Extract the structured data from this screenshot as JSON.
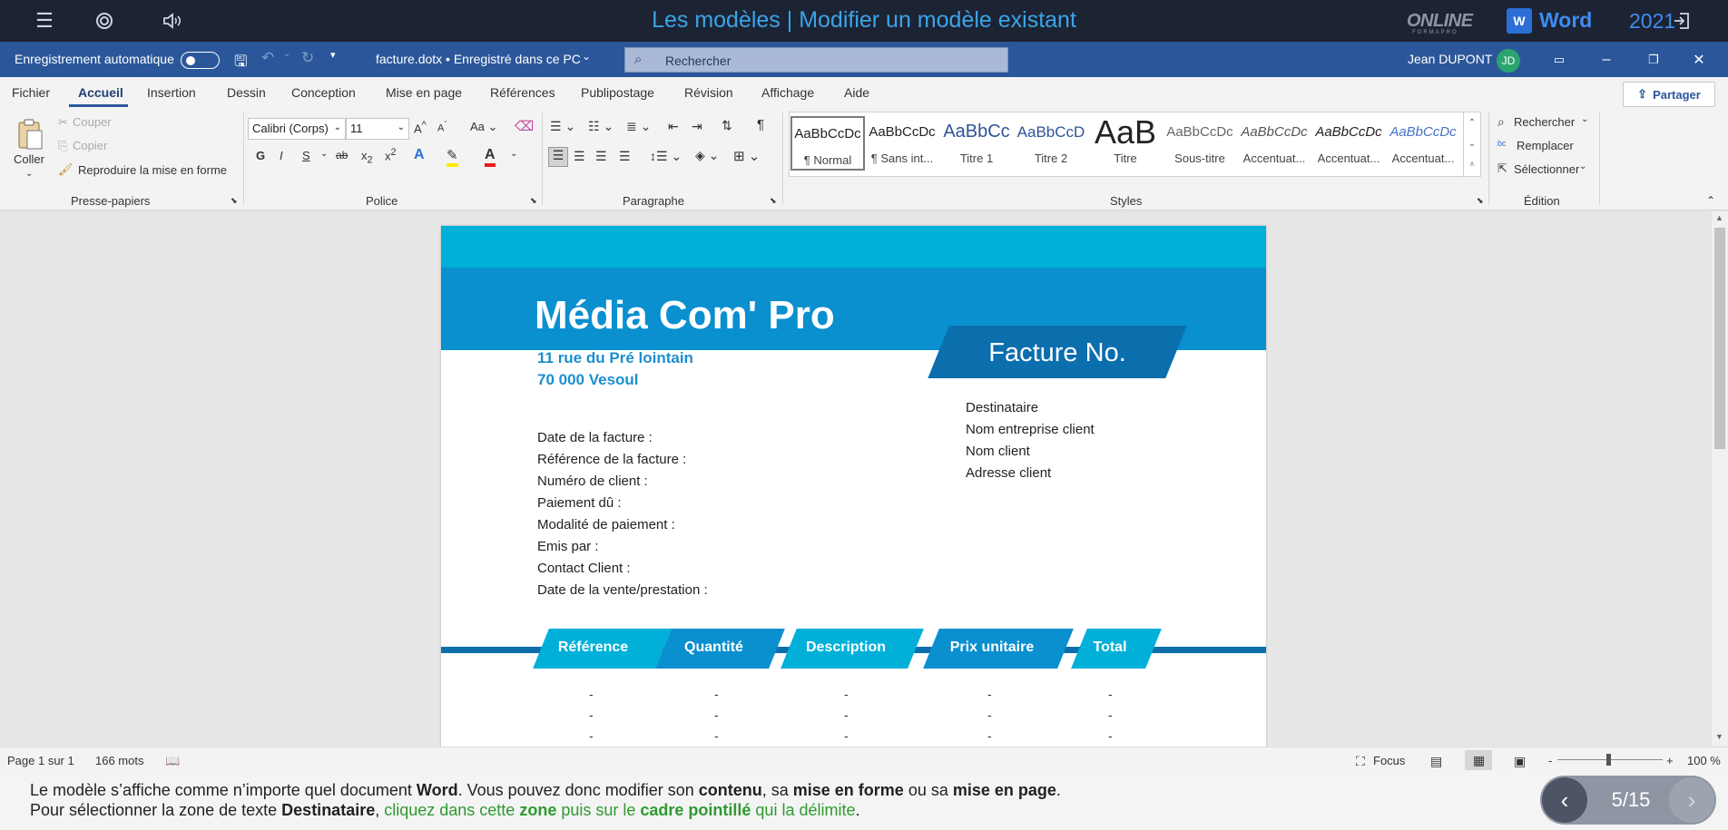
{
  "course": {
    "title": "Les modèles | Modifier un modèle existant",
    "online_logo": "ONLINE",
    "online_sub": "FORMAPRO",
    "word_label": "Word",
    "word_year": "2021",
    "word_letter": "W"
  },
  "titlebar": {
    "autosave": "Enregistrement automatique",
    "filename": "facture.dotx • Enregistré dans ce PC",
    "search_placeholder": "Rechercher",
    "user": "Jean DUPONT",
    "initials": "JD"
  },
  "menu": {
    "tabs": [
      "Fichier",
      "Accueil",
      "Insertion",
      "Dessin",
      "Conception",
      "Mise en page",
      "Références",
      "Publipostage",
      "Révision",
      "Affichage",
      "Aide"
    ],
    "share": "Partager"
  },
  "ribbon": {
    "clipboard": {
      "paste": "Coller",
      "cut": "Couper",
      "copy": "Copier",
      "format_painter": "Reproduire la mise en forme",
      "label": "Presse-papiers"
    },
    "font": {
      "name": "Calibri (Corps)",
      "size": "11",
      "label": "Police",
      "bold": "G",
      "italic": "I",
      "underline": "S"
    },
    "paragraph": {
      "label": "Paragraphe"
    },
    "styles": {
      "label": "Styles",
      "items": [
        {
          "sample": "AaBbCcDc",
          "name": "¶ Normal"
        },
        {
          "sample": "AaBbCcDc",
          "name": "¶ Sans int..."
        },
        {
          "sample": "AaBbCc",
          "name": "Titre 1"
        },
        {
          "sample": "AaBbCcD",
          "name": "Titre 2"
        },
        {
          "sample": "AaB",
          "name": "Titre"
        },
        {
          "sample": "AaBbCcDc",
          "name": "Sous-titre"
        },
        {
          "sample": "AaBbCcDc",
          "name": "Accentuat..."
        },
        {
          "sample": "AaBbCcDc",
          "name": "Accentuat..."
        },
        {
          "sample": "AaBbCcDc",
          "name": "Accentuat..."
        }
      ]
    },
    "editing": {
      "find": "Rechercher",
      "replace": "Remplacer",
      "select": "Sélectionner",
      "label": "Édition"
    }
  },
  "document": {
    "company": "Média Com' Pro",
    "facture": "Facture No.",
    "address": [
      "11 rue du Pré lointain",
      "70 000 Vesoul"
    ],
    "fields": [
      "Date de la facture :",
      "Référence de la facture :",
      "Numéro de client :",
      "Paiement dû :",
      "Modalité de paiement :",
      "Emis par :",
      "Contact Client :",
      "Date de la vente/prestation :"
    ],
    "client": [
      "Destinataire",
      "Nom entreprise client",
      "Nom client",
      "Adresse client"
    ],
    "headers": [
      "Référence",
      "Quantité",
      "Description",
      "Prix unitaire",
      "Total"
    ],
    "dash": "-"
  },
  "status": {
    "page": "Page 1 sur 1",
    "words": "166 mots",
    "focus": "Focus",
    "zoom": "100 %"
  },
  "caption": {
    "line1_a": "Le modèle s’affiche comme n’importe quel document ",
    "line1_b": "Word",
    "line1_c": ". Vous pouvez donc modifier son ",
    "line1_d": "contenu",
    "line1_e": ", sa ",
    "line1_f": "mise en forme",
    "line1_g": " ou sa ",
    "line1_h": "mise en page",
    "line1_i": ".",
    "line2_a": "Pour sélectionner la zone de texte ",
    "line2_b": "Destinataire",
    "line2_c": ", ",
    "line2_d": "cliquez dans cette ",
    "line2_e": "zone",
    "line2_f": " puis sur le ",
    "line2_g": "cadre pointillé",
    "line2_h": " qui la délimite",
    "line2_i": ".",
    "pager": "5/15"
  },
  "colors": {
    "band_light": "#00b0d9",
    "band_dark": "#0a8fcf",
    "accent": "#0b6fae",
    "word_blue": "#2b579a"
  }
}
